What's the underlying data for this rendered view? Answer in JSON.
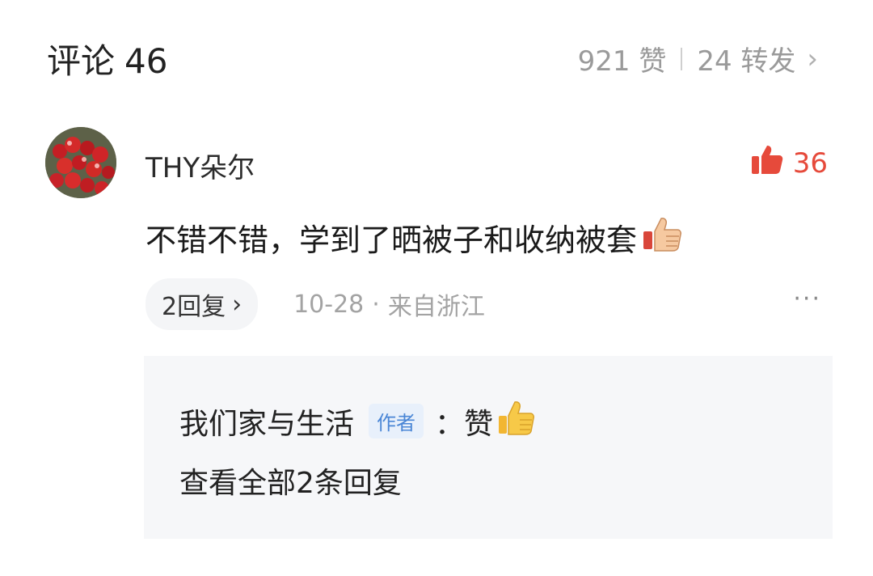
{
  "header": {
    "title": "评论",
    "count": "46",
    "likes": "921 赞",
    "reposts": "24 转发"
  },
  "comment": {
    "username": "THY朵尔",
    "like_count": "36",
    "text": "不错不错，学到了晒被子和收纳被套",
    "reply_button": "2回复",
    "date": "10-28",
    "location": "来自浙江",
    "more": "···"
  },
  "sub_replies": {
    "reply_user": "我们家与生活",
    "author_badge": "作者",
    "reply_text": "：赞",
    "view_all": "查看全部2条回复"
  },
  "colors": {
    "like_accent": "#e64a3b",
    "badge_blue": "#4a86d6",
    "muted": "#9a9a9a",
    "sub_bg": "#f6f7f9"
  },
  "icons": {
    "like": "thumbs-up-icon",
    "emoji_thumb": "thumbs-up-emoji-icon",
    "chevron": "chevron-right-icon",
    "more": "more-dots-icon"
  }
}
